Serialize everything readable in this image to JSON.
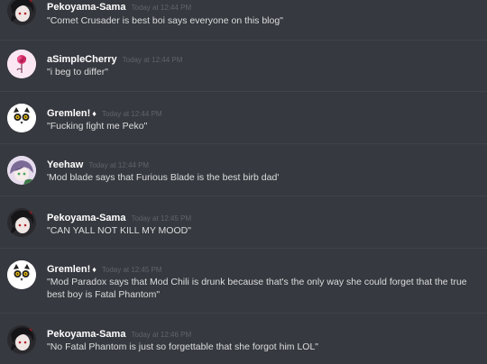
{
  "messages": [
    {
      "username": "Pekoyama-Sama",
      "timestamp": "Today at 12:44 PM",
      "badge": "",
      "text": "\"Comet Crusader is best boi says everyone on this blog\"",
      "avatar_icon": "dark-haired-character-avatar"
    },
    {
      "username": "aSimpleCherry",
      "timestamp": "Today at 12:44 PM",
      "badge": "",
      "text": "\"i beg to differ\"",
      "avatar_icon": "pink-rose-avatar"
    },
    {
      "username": "Gremlen!",
      "timestamp": "Today at 12:44 PM",
      "badge": "♦",
      "text": "\"Fucking fight me Peko\"",
      "avatar_icon": "white-owl-avatar"
    },
    {
      "username": "Yeehaw",
      "timestamp": "Today at 12:44 PM",
      "badge": "",
      "text": "'Mod blade says that Furious Blade is the best birb dad'",
      "avatar_icon": "purple-anime-character-avatar"
    },
    {
      "username": "Pekoyama-Sama",
      "timestamp": "Today at 12:45 PM",
      "badge": "",
      "text": "\"CAN YALL NOT KILL MY MOOD\"",
      "avatar_icon": "dark-haired-character-avatar"
    },
    {
      "username": "Gremlen!",
      "timestamp": "Today at 12:45 PM",
      "badge": "♦",
      "text": "\"Mod Paradox says that Mod Chili is drunk because that's the only way she could forget that the true best boy is Fatal Phantom\"",
      "avatar_icon": "white-owl-avatar"
    },
    {
      "username": "Pekoyama-Sama",
      "timestamp": "Today at 12:46 PM",
      "badge": "",
      "text": "\"No Fatal Phantom is just so forgettable that she forgot him LOL\"",
      "avatar_icon": "dark-haired-character-avatar"
    }
  ],
  "colors": {
    "background": "#36393f",
    "username": "#ffffff",
    "message_text": "#dcddde",
    "timestamp": "#5f646c",
    "divider": "#40434a"
  }
}
